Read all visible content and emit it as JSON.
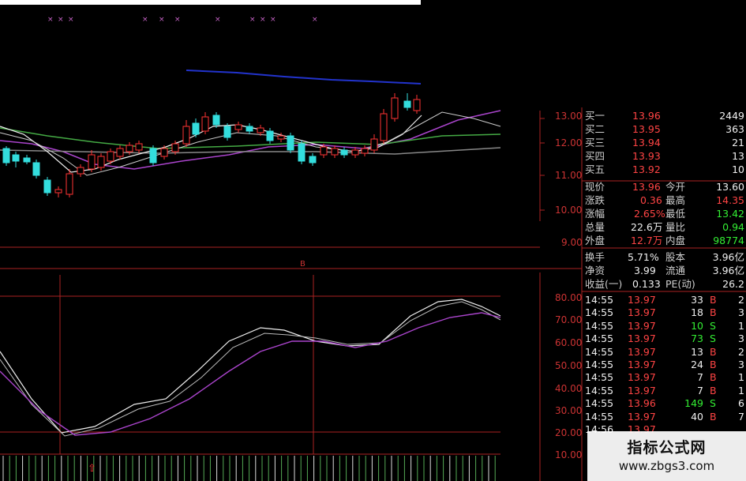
{
  "price_axis": [
    "13.00",
    "12.00",
    "11.00",
    "10.00",
    "9.00"
  ],
  "osc_axis": [
    "80.00",
    "70.00",
    "60.00",
    "50.00",
    "40.00",
    "30.00",
    "20.00",
    "10.00"
  ],
  "bid_ask": [
    {
      "label": "买一",
      "price": "13.96",
      "vol": "2449"
    },
    {
      "label": "买二",
      "price": "13.95",
      "vol": "363"
    },
    {
      "label": "买三",
      "price": "13.94",
      "vol": "21"
    },
    {
      "label": "买四",
      "price": "13.93",
      "vol": "13"
    },
    {
      "label": "买五",
      "price": "13.92",
      "vol": "10"
    }
  ],
  "stats": [
    {
      "l1": "现价",
      "v1": "13.96",
      "l2": "今开",
      "v2": "13.60"
    },
    {
      "l1": "涨跌",
      "v1": "0.36",
      "l2": "最高",
      "v2": "14.35"
    },
    {
      "l1": "涨幅",
      "v1": "2.65%",
      "l2": "最低",
      "v2": "13.42"
    },
    {
      "l1": "总量",
      "v1": "22.6万",
      "l2": "量比",
      "v2": "0.94"
    },
    {
      "l1": "外盘",
      "v1": "12.7万",
      "l2": "内盘",
      "v2": "98774"
    }
  ],
  "stats2": [
    {
      "l1": "换手",
      "v1": "5.71%",
      "l2": "股本",
      "v2": "3.96亿"
    },
    {
      "l1": "净资",
      "v1": "3.99",
      "l2": "流通",
      "v2": "3.96亿"
    },
    {
      "l1": "收益(一)",
      "v1": "0.133",
      "l2": "PE(动)",
      "v2": "26.2"
    }
  ],
  "ticks": [
    {
      "time": "14:55",
      "price": "13.97",
      "vol": "33",
      "side": "B",
      "n": "2"
    },
    {
      "time": "14:55",
      "price": "13.97",
      "vol": "18",
      "side": "B",
      "n": "3"
    },
    {
      "time": "14:55",
      "price": "13.97",
      "vol": "10",
      "side": "S",
      "n": "1"
    },
    {
      "time": "14:55",
      "price": "13.97",
      "vol": "73",
      "side": "S",
      "n": "3"
    },
    {
      "time": "14:55",
      "price": "13.97",
      "vol": "13",
      "side": "B",
      "n": "2"
    },
    {
      "time": "14:55",
      "price": "13.97",
      "vol": "24",
      "side": "B",
      "n": "3"
    },
    {
      "time": "14:55",
      "price": "13.97",
      "vol": "7",
      "side": "B",
      "n": "1"
    },
    {
      "time": "14:55",
      "price": "13.97",
      "vol": "7",
      "side": "B",
      "n": "1"
    },
    {
      "time": "14:55",
      "price": "13.96",
      "vol": "149",
      "side": "S",
      "n": "6"
    },
    {
      "time": "14:55",
      "price": "13.97",
      "vol": "40",
      "side": "B",
      "n": "7"
    },
    {
      "time": "14:56",
      "price": "13.97",
      "vol": "",
      "side": "",
      "n": ""
    }
  ],
  "watermark": {
    "title": "指标公式网",
    "url": "www.zbgs3.com"
  },
  "colors": {
    "up": "#ff3333",
    "down": "#33dddd",
    "frame": "#aa2222",
    "ma_blue": "#2233cc",
    "ma_purple": "#aa44cc",
    "ma_green": "#44aa44"
  }
}
